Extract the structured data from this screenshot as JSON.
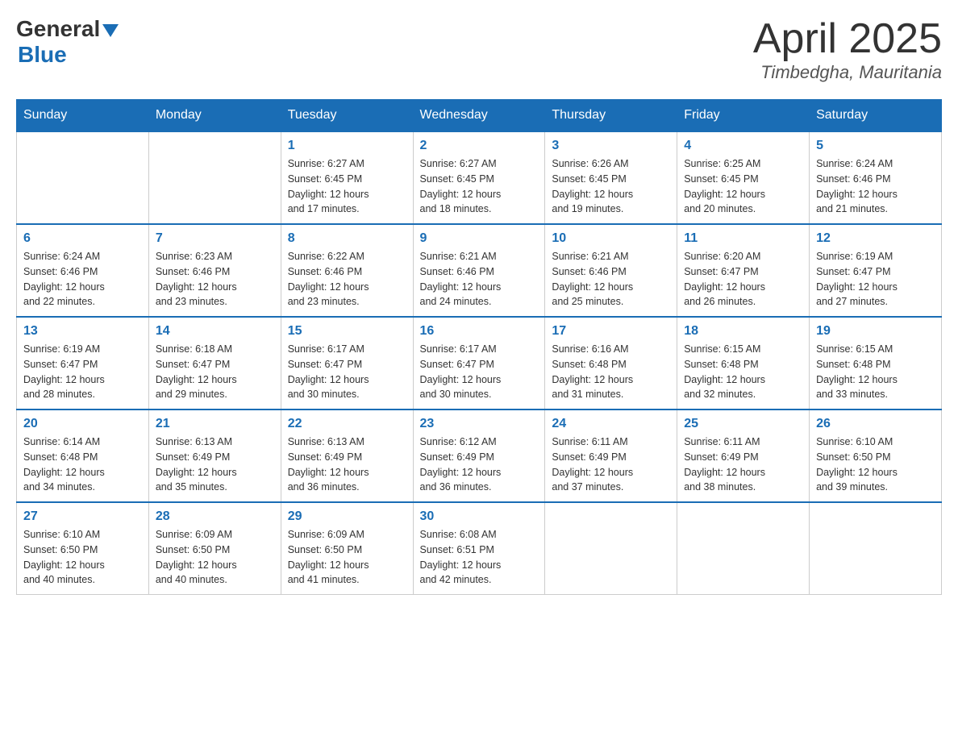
{
  "header": {
    "logo_general": "General",
    "logo_blue": "Blue",
    "month_title": "April 2025",
    "location": "Timbedgha, Mauritania"
  },
  "days_of_week": [
    "Sunday",
    "Monday",
    "Tuesday",
    "Wednesday",
    "Thursday",
    "Friday",
    "Saturday"
  ],
  "weeks": [
    [
      {
        "day": "",
        "info": ""
      },
      {
        "day": "",
        "info": ""
      },
      {
        "day": "1",
        "info": "Sunrise: 6:27 AM\nSunset: 6:45 PM\nDaylight: 12 hours\nand 17 minutes."
      },
      {
        "day": "2",
        "info": "Sunrise: 6:27 AM\nSunset: 6:45 PM\nDaylight: 12 hours\nand 18 minutes."
      },
      {
        "day": "3",
        "info": "Sunrise: 6:26 AM\nSunset: 6:45 PM\nDaylight: 12 hours\nand 19 minutes."
      },
      {
        "day": "4",
        "info": "Sunrise: 6:25 AM\nSunset: 6:45 PM\nDaylight: 12 hours\nand 20 minutes."
      },
      {
        "day": "5",
        "info": "Sunrise: 6:24 AM\nSunset: 6:46 PM\nDaylight: 12 hours\nand 21 minutes."
      }
    ],
    [
      {
        "day": "6",
        "info": "Sunrise: 6:24 AM\nSunset: 6:46 PM\nDaylight: 12 hours\nand 22 minutes."
      },
      {
        "day": "7",
        "info": "Sunrise: 6:23 AM\nSunset: 6:46 PM\nDaylight: 12 hours\nand 23 minutes."
      },
      {
        "day": "8",
        "info": "Sunrise: 6:22 AM\nSunset: 6:46 PM\nDaylight: 12 hours\nand 23 minutes."
      },
      {
        "day": "9",
        "info": "Sunrise: 6:21 AM\nSunset: 6:46 PM\nDaylight: 12 hours\nand 24 minutes."
      },
      {
        "day": "10",
        "info": "Sunrise: 6:21 AM\nSunset: 6:46 PM\nDaylight: 12 hours\nand 25 minutes."
      },
      {
        "day": "11",
        "info": "Sunrise: 6:20 AM\nSunset: 6:47 PM\nDaylight: 12 hours\nand 26 minutes."
      },
      {
        "day": "12",
        "info": "Sunrise: 6:19 AM\nSunset: 6:47 PM\nDaylight: 12 hours\nand 27 minutes."
      }
    ],
    [
      {
        "day": "13",
        "info": "Sunrise: 6:19 AM\nSunset: 6:47 PM\nDaylight: 12 hours\nand 28 minutes."
      },
      {
        "day": "14",
        "info": "Sunrise: 6:18 AM\nSunset: 6:47 PM\nDaylight: 12 hours\nand 29 minutes."
      },
      {
        "day": "15",
        "info": "Sunrise: 6:17 AM\nSunset: 6:47 PM\nDaylight: 12 hours\nand 30 minutes."
      },
      {
        "day": "16",
        "info": "Sunrise: 6:17 AM\nSunset: 6:47 PM\nDaylight: 12 hours\nand 30 minutes."
      },
      {
        "day": "17",
        "info": "Sunrise: 6:16 AM\nSunset: 6:48 PM\nDaylight: 12 hours\nand 31 minutes."
      },
      {
        "day": "18",
        "info": "Sunrise: 6:15 AM\nSunset: 6:48 PM\nDaylight: 12 hours\nand 32 minutes."
      },
      {
        "day": "19",
        "info": "Sunrise: 6:15 AM\nSunset: 6:48 PM\nDaylight: 12 hours\nand 33 minutes."
      }
    ],
    [
      {
        "day": "20",
        "info": "Sunrise: 6:14 AM\nSunset: 6:48 PM\nDaylight: 12 hours\nand 34 minutes."
      },
      {
        "day": "21",
        "info": "Sunrise: 6:13 AM\nSunset: 6:49 PM\nDaylight: 12 hours\nand 35 minutes."
      },
      {
        "day": "22",
        "info": "Sunrise: 6:13 AM\nSunset: 6:49 PM\nDaylight: 12 hours\nand 36 minutes."
      },
      {
        "day": "23",
        "info": "Sunrise: 6:12 AM\nSunset: 6:49 PM\nDaylight: 12 hours\nand 36 minutes."
      },
      {
        "day": "24",
        "info": "Sunrise: 6:11 AM\nSunset: 6:49 PM\nDaylight: 12 hours\nand 37 minutes."
      },
      {
        "day": "25",
        "info": "Sunrise: 6:11 AM\nSunset: 6:49 PM\nDaylight: 12 hours\nand 38 minutes."
      },
      {
        "day": "26",
        "info": "Sunrise: 6:10 AM\nSunset: 6:50 PM\nDaylight: 12 hours\nand 39 minutes."
      }
    ],
    [
      {
        "day": "27",
        "info": "Sunrise: 6:10 AM\nSunset: 6:50 PM\nDaylight: 12 hours\nand 40 minutes."
      },
      {
        "day": "28",
        "info": "Sunrise: 6:09 AM\nSunset: 6:50 PM\nDaylight: 12 hours\nand 40 minutes."
      },
      {
        "day": "29",
        "info": "Sunrise: 6:09 AM\nSunset: 6:50 PM\nDaylight: 12 hours\nand 41 minutes."
      },
      {
        "day": "30",
        "info": "Sunrise: 6:08 AM\nSunset: 6:51 PM\nDaylight: 12 hours\nand 42 minutes."
      },
      {
        "day": "",
        "info": ""
      },
      {
        "day": "",
        "info": ""
      },
      {
        "day": "",
        "info": ""
      }
    ]
  ]
}
